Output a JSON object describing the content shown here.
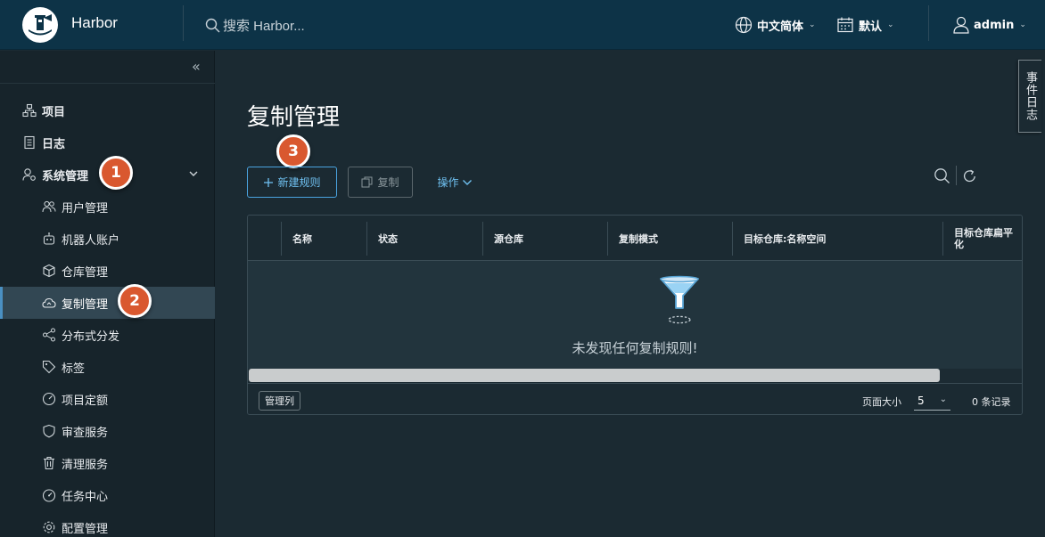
{
  "header": {
    "app_name": "Harbor",
    "search_placeholder": "搜索 Harbor...",
    "language": "中文简体",
    "date_format": "默认",
    "user": "admin"
  },
  "sidebar": {
    "items": [
      {
        "label": "项目",
        "icon": "projects-icon"
      },
      {
        "label": "日志",
        "icon": "log-icon"
      },
      {
        "label": "系统管理",
        "icon": "admin-icon",
        "expanded": true
      },
      {
        "label": "用户管理",
        "icon": "users-icon"
      },
      {
        "label": "机器人账户",
        "icon": "robot-icon"
      },
      {
        "label": "仓库管理",
        "icon": "registry-icon"
      },
      {
        "label": "复制管理",
        "icon": "replication-icon",
        "active": true
      },
      {
        "label": "分布式分发",
        "icon": "share-icon"
      },
      {
        "label": "标签",
        "icon": "tag-icon"
      },
      {
        "label": "项目定额",
        "icon": "quota-icon"
      },
      {
        "label": "审查服务",
        "icon": "shield-icon"
      },
      {
        "label": "清理服务",
        "icon": "trash-icon"
      },
      {
        "label": "任务中心",
        "icon": "dashboard-icon"
      },
      {
        "label": "配置管理",
        "icon": "gear-icon"
      }
    ]
  },
  "badges": [
    "1",
    "2",
    "3"
  ],
  "main": {
    "title": "复制管理",
    "new_rule_label": "新建规则",
    "copy_label": "复制",
    "actions_label": "操作",
    "columns": [
      "名称",
      "状态",
      "源仓库",
      "复制模式",
      "目标仓库:名称空间",
      "目标仓库扁平化"
    ],
    "empty_text": "未发现任何复制规则!",
    "manage_columns_label": "管理列",
    "page_size_label": "页面大小",
    "page_size_value": "5",
    "record_count": "0 条记录"
  },
  "event_log_label": "事件日志",
  "colors": {
    "header_bg": "#0d3347",
    "sidebar_bg": "#17242b",
    "main_bg": "#1b2a32",
    "accent": "#4aa3df",
    "badge": "#d9582f"
  }
}
